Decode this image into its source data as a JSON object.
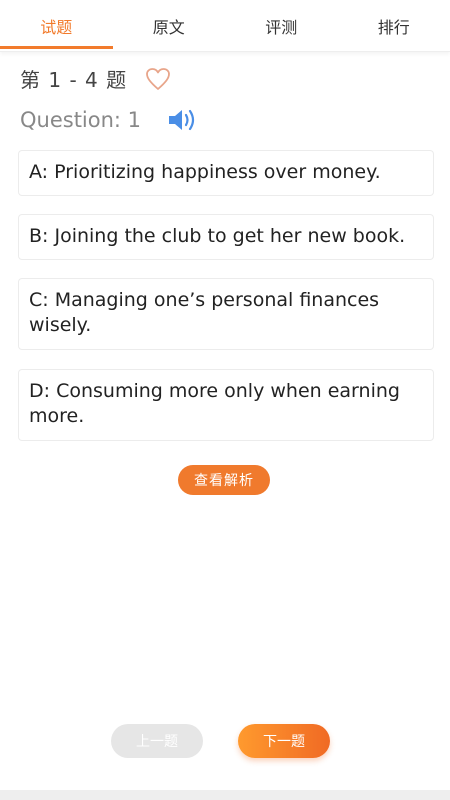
{
  "tabs": [
    {
      "label": "试题",
      "active": true
    },
    {
      "label": "原文",
      "active": false
    },
    {
      "label": "评测",
      "active": false
    },
    {
      "label": "排行",
      "active": false
    }
  ],
  "question_range": "第 1 - 4 题",
  "question_label": "Question: 1",
  "icons": {
    "favorite": "heart-icon",
    "audio": "speaker-icon"
  },
  "options": [
    {
      "text": "A: Prioritizing happiness over money."
    },
    {
      "text": "B: Joining the club to get her new book."
    },
    {
      "text": "C: Managing one’s personal finances wisely."
    },
    {
      "text": "D: Consuming more only when earning more."
    }
  ],
  "buttons": {
    "analysis": "查看解析",
    "prev": "上一题",
    "next": "下一题"
  },
  "colors": {
    "accent": "#f27b2c",
    "speaker": "#4a8ee6",
    "heart": "#e8a58a"
  }
}
